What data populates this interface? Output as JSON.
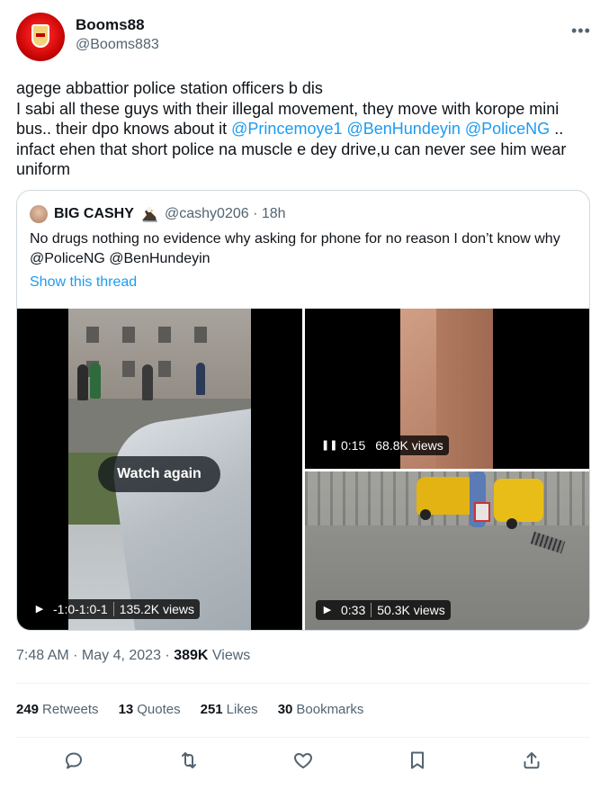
{
  "author": {
    "display_name": "Booms88",
    "handle": "@Booms883",
    "avatar_icon": "arsenal-crest-icon"
  },
  "tweet": {
    "line1": "agege abbattior police station officers b dis",
    "line2": "I sabi all these guys with their illegal movement, they move with korope mini bus.. their dpo knows about it ",
    "mention1": "@Princemoye1",
    "mention2": "@BenHundeyin",
    "mention3": "@PoliceNG",
    "line3": " .. infact ehen that short police na muscle e dey drive,u can never see him wear uniform"
  },
  "quote": {
    "name": "BIG CASHY",
    "handle": "@cashy0206 · 18h",
    "text": "No drugs nothing no evidence why asking for phone for no reason I don’t know why @PoliceNG @BenHundeyin",
    "show_thread": "Show this thread",
    "media": [
      {
        "control": "play",
        "duration": "-1:0-1:0-1",
        "views": "135.2K views",
        "overlay": "Watch again"
      },
      {
        "control": "pause",
        "duration": "0:15",
        "views": "68.8K views"
      },
      {
        "control": "play",
        "duration": "0:33",
        "views": "50.3K views"
      }
    ]
  },
  "meta": {
    "time": "7:48 AM · May 4, 2023 · ",
    "views_count": "389K",
    "views_label": " Views"
  },
  "stats": {
    "retweets_count": "249",
    "retweets_label": "Retweets",
    "quotes_count": "13",
    "quotes_label": "Quotes",
    "likes_count": "251",
    "likes_label": "Likes",
    "bookmarks_count": "30",
    "bookmarks_label": "Bookmarks"
  },
  "actions": [
    "reply-icon",
    "retweet-icon",
    "like-icon",
    "bookmark-icon",
    "share-icon"
  ],
  "colors": {
    "link": "#1d9bf0",
    "secondary": "#536471",
    "text": "#0f1419",
    "border": "#cfd9de"
  }
}
